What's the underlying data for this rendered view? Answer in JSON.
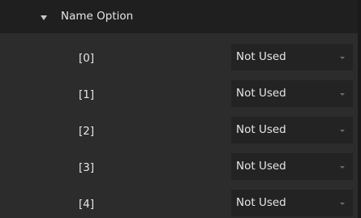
{
  "section": {
    "title": "Name Option",
    "expanded": true
  },
  "rows": [
    {
      "index_label": "[0]",
      "value": "Not Used"
    },
    {
      "index_label": "[1]",
      "value": "Not Used"
    },
    {
      "index_label": "[2]",
      "value": "Not Used"
    },
    {
      "index_label": "[3]",
      "value": "Not Used"
    },
    {
      "index_label": "[4]",
      "value": "Not Used"
    }
  ],
  "icons": {
    "section_toggle": "chevron-down-icon",
    "select_caret": "caret-down-icon"
  },
  "colors": {
    "panel_background": "#2c2c2c",
    "header_background": "#1f1f1f",
    "select_background": "#232323",
    "text": "#e6e6e6"
  }
}
